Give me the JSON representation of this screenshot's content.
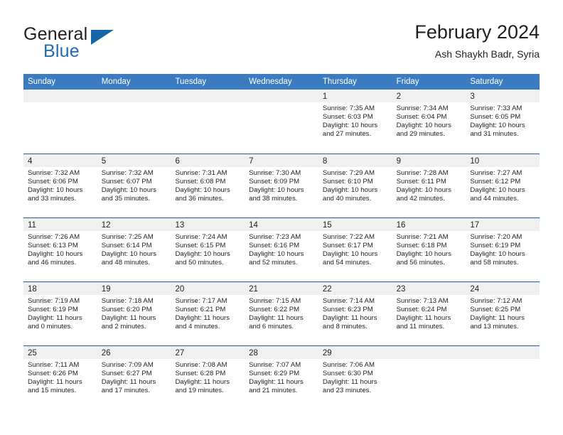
{
  "brand": {
    "name_top": "General",
    "name_bottom": "Blue",
    "accent_color": "#1565a8"
  },
  "header": {
    "title": "February 2024",
    "subtitle": "Ash Shaykh Badr, Syria"
  },
  "colors": {
    "header_row_bg": "#3b7cc0",
    "row_divider": "#1f5fa6",
    "day_band_bg": "#f0f0f0",
    "text": "#231f20"
  },
  "weekdays": [
    "Sunday",
    "Monday",
    "Tuesday",
    "Wednesday",
    "Thursday",
    "Friday",
    "Saturday"
  ],
  "weeks": [
    [
      {
        "day": "",
        "lines": []
      },
      {
        "day": "",
        "lines": []
      },
      {
        "day": "",
        "lines": []
      },
      {
        "day": "",
        "lines": []
      },
      {
        "day": "1",
        "lines": [
          "Sunrise: 7:35 AM",
          "Sunset: 6:03 PM",
          "Daylight: 10 hours",
          "and 27 minutes."
        ]
      },
      {
        "day": "2",
        "lines": [
          "Sunrise: 7:34 AM",
          "Sunset: 6:04 PM",
          "Daylight: 10 hours",
          "and 29 minutes."
        ]
      },
      {
        "day": "3",
        "lines": [
          "Sunrise: 7:33 AM",
          "Sunset: 6:05 PM",
          "Daylight: 10 hours",
          "and 31 minutes."
        ]
      }
    ],
    [
      {
        "day": "4",
        "lines": [
          "Sunrise: 7:32 AM",
          "Sunset: 6:06 PM",
          "Daylight: 10 hours",
          "and 33 minutes."
        ]
      },
      {
        "day": "5",
        "lines": [
          "Sunrise: 7:32 AM",
          "Sunset: 6:07 PM",
          "Daylight: 10 hours",
          "and 35 minutes."
        ]
      },
      {
        "day": "6",
        "lines": [
          "Sunrise: 7:31 AM",
          "Sunset: 6:08 PM",
          "Daylight: 10 hours",
          "and 36 minutes."
        ]
      },
      {
        "day": "7",
        "lines": [
          "Sunrise: 7:30 AM",
          "Sunset: 6:09 PM",
          "Daylight: 10 hours",
          "and 38 minutes."
        ]
      },
      {
        "day": "8",
        "lines": [
          "Sunrise: 7:29 AM",
          "Sunset: 6:10 PM",
          "Daylight: 10 hours",
          "and 40 minutes."
        ]
      },
      {
        "day": "9",
        "lines": [
          "Sunrise: 7:28 AM",
          "Sunset: 6:11 PM",
          "Daylight: 10 hours",
          "and 42 minutes."
        ]
      },
      {
        "day": "10",
        "lines": [
          "Sunrise: 7:27 AM",
          "Sunset: 6:12 PM",
          "Daylight: 10 hours",
          "and 44 minutes."
        ]
      }
    ],
    [
      {
        "day": "11",
        "lines": [
          "Sunrise: 7:26 AM",
          "Sunset: 6:13 PM",
          "Daylight: 10 hours",
          "and 46 minutes."
        ]
      },
      {
        "day": "12",
        "lines": [
          "Sunrise: 7:25 AM",
          "Sunset: 6:14 PM",
          "Daylight: 10 hours",
          "and 48 minutes."
        ]
      },
      {
        "day": "13",
        "lines": [
          "Sunrise: 7:24 AM",
          "Sunset: 6:15 PM",
          "Daylight: 10 hours",
          "and 50 minutes."
        ]
      },
      {
        "day": "14",
        "lines": [
          "Sunrise: 7:23 AM",
          "Sunset: 6:16 PM",
          "Daylight: 10 hours",
          "and 52 minutes."
        ]
      },
      {
        "day": "15",
        "lines": [
          "Sunrise: 7:22 AM",
          "Sunset: 6:17 PM",
          "Daylight: 10 hours",
          "and 54 minutes."
        ]
      },
      {
        "day": "16",
        "lines": [
          "Sunrise: 7:21 AM",
          "Sunset: 6:18 PM",
          "Daylight: 10 hours",
          "and 56 minutes."
        ]
      },
      {
        "day": "17",
        "lines": [
          "Sunrise: 7:20 AM",
          "Sunset: 6:19 PM",
          "Daylight: 10 hours",
          "and 58 minutes."
        ]
      }
    ],
    [
      {
        "day": "18",
        "lines": [
          "Sunrise: 7:19 AM",
          "Sunset: 6:19 PM",
          "Daylight: 11 hours",
          "and 0 minutes."
        ]
      },
      {
        "day": "19",
        "lines": [
          "Sunrise: 7:18 AM",
          "Sunset: 6:20 PM",
          "Daylight: 11 hours",
          "and 2 minutes."
        ]
      },
      {
        "day": "20",
        "lines": [
          "Sunrise: 7:17 AM",
          "Sunset: 6:21 PM",
          "Daylight: 11 hours",
          "and 4 minutes."
        ]
      },
      {
        "day": "21",
        "lines": [
          "Sunrise: 7:15 AM",
          "Sunset: 6:22 PM",
          "Daylight: 11 hours",
          "and 6 minutes."
        ]
      },
      {
        "day": "22",
        "lines": [
          "Sunrise: 7:14 AM",
          "Sunset: 6:23 PM",
          "Daylight: 11 hours",
          "and 8 minutes."
        ]
      },
      {
        "day": "23",
        "lines": [
          "Sunrise: 7:13 AM",
          "Sunset: 6:24 PM",
          "Daylight: 11 hours",
          "and 11 minutes."
        ]
      },
      {
        "day": "24",
        "lines": [
          "Sunrise: 7:12 AM",
          "Sunset: 6:25 PM",
          "Daylight: 11 hours",
          "and 13 minutes."
        ]
      }
    ],
    [
      {
        "day": "25",
        "lines": [
          "Sunrise: 7:11 AM",
          "Sunset: 6:26 PM",
          "Daylight: 11 hours",
          "and 15 minutes."
        ]
      },
      {
        "day": "26",
        "lines": [
          "Sunrise: 7:09 AM",
          "Sunset: 6:27 PM",
          "Daylight: 11 hours",
          "and 17 minutes."
        ]
      },
      {
        "day": "27",
        "lines": [
          "Sunrise: 7:08 AM",
          "Sunset: 6:28 PM",
          "Daylight: 11 hours",
          "and 19 minutes."
        ]
      },
      {
        "day": "28",
        "lines": [
          "Sunrise: 7:07 AM",
          "Sunset: 6:29 PM",
          "Daylight: 11 hours",
          "and 21 minutes."
        ]
      },
      {
        "day": "29",
        "lines": [
          "Sunrise: 7:06 AM",
          "Sunset: 6:30 PM",
          "Daylight: 11 hours",
          "and 23 minutes."
        ]
      },
      {
        "day": "",
        "lines": []
      },
      {
        "day": "",
        "lines": []
      }
    ]
  ]
}
